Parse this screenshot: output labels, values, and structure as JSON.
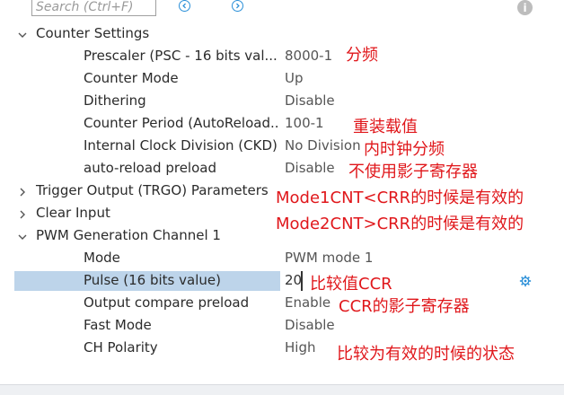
{
  "toolbar": {
    "search_placeholder": "Search (Ctrl+F)",
    "prev_icon": "chevron-left-icon",
    "next_icon": "chevron-right-icon",
    "info_icon": "info-icon",
    "info_glyph": "i"
  },
  "tree": {
    "counter_settings": {
      "label": "Counter Settings",
      "expanded": true,
      "items": [
        {
          "name": "Prescaler (PSC - 16 bits val...",
          "value": "8000-1"
        },
        {
          "name": "Counter Mode",
          "value": "Up"
        },
        {
          "name": "Dithering",
          "value": "Disable"
        },
        {
          "name": "Counter Period (AutoReload...",
          "value": "100-1"
        },
        {
          "name": "Internal Clock Division (CKD)",
          "value": "No Division"
        },
        {
          "name": "auto-reload preload",
          "value": "Disable"
        }
      ]
    },
    "trigger_output": {
      "label": "Trigger Output (TRGO) Parameters",
      "expanded": false
    },
    "clear_input": {
      "label": "Clear Input",
      "expanded": false
    },
    "pwm_channel": {
      "label": "PWM Generation Channel 1",
      "expanded": true,
      "items": [
        {
          "name": "Mode",
          "value": "PWM mode 1"
        },
        {
          "name": "Pulse (16 bits value)",
          "value": "20",
          "selected": true
        },
        {
          "name": "Output compare preload",
          "value": "Enable"
        },
        {
          "name": "Fast Mode",
          "value": "Disable"
        },
        {
          "name": "CH Polarity",
          "value": "High"
        }
      ]
    }
  },
  "annotations": {
    "prescaler": "分频",
    "period": "重装载值",
    "ckd": "内时钟分频",
    "arpe": "不使用影子寄存器",
    "mode1": "Mode1CNT<CRR的时候是有效的",
    "mode2": "Mode2CNT>CRR的时候是有效的",
    "pulse": "比较值CCR",
    "preload": "CCR的影子寄存器",
    "polarity": "比较为有效的时候的状态"
  },
  "colors": {
    "annotation": "#e0171b",
    "selection": "#bdd4ea",
    "accent": "#2a8fd8"
  }
}
